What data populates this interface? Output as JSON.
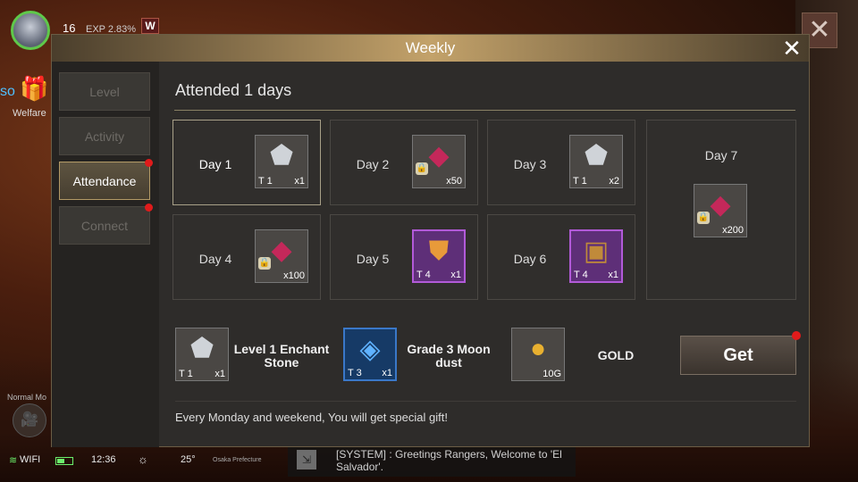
{
  "hud": {
    "level": "16",
    "exp": "EXP 2.83%",
    "badge": "W",
    "side_text": "so",
    "welfare_label": "Welfare",
    "normal_mode": "Normal Mo",
    "close_icon": "close-icon"
  },
  "statusbar": {
    "wifi": "WIFI",
    "time": "12:36",
    "temp": "25°",
    "location": "Osaka Prefecture"
  },
  "chat": {
    "text": "[SYSTEM] : Greetings Rangers, Welcome to 'El Salvador'."
  },
  "dialog": {
    "title": "Weekly",
    "heading": "Attended 1 days",
    "footer": "Every Monday and weekend, You will get special gift!",
    "get_label": "Get"
  },
  "tabs": [
    {
      "label": "Level",
      "active": false,
      "dot": false
    },
    {
      "label": "Activity",
      "active": false,
      "dot": false
    },
    {
      "label": "Attendance",
      "active": true,
      "dot": true
    },
    {
      "label": "Connect",
      "active": false,
      "dot": true
    }
  ],
  "days": [
    {
      "label": "Day 1",
      "item": "enchant-stone",
      "tier": "T 1",
      "qty": "x1",
      "locked": false,
      "current": true
    },
    {
      "label": "Day 2",
      "item": "ruby-gem",
      "tier": "",
      "qty": "x50",
      "locked": true,
      "current": false
    },
    {
      "label": "Day 3",
      "item": "enchant-stone",
      "tier": "T 1",
      "qty": "x2",
      "locked": false,
      "current": false
    },
    {
      "label": "Day 4",
      "item": "ruby-gem",
      "tier": "",
      "qty": "x100",
      "locked": true,
      "current": false
    },
    {
      "label": "Day 5",
      "item": "armor-piece",
      "tier": "T 4",
      "qty": "x1",
      "locked": false,
      "current": false
    },
    {
      "label": "Day 6",
      "item": "treasure-chest",
      "tier": "T 4",
      "qty": "x1",
      "locked": false,
      "current": false
    },
    {
      "label": "Day 7",
      "item": "ruby-gem",
      "tier": "",
      "qty": "x200",
      "locked": true,
      "current": false
    }
  ],
  "rewards": [
    {
      "name": "Level 1 Enchant Stone",
      "tier": "T 1",
      "qty": "x1",
      "item": "enchant-stone"
    },
    {
      "name": "Grade 3 Moon dust",
      "tier": "T 3",
      "qty": "x1",
      "item": "moon-dust"
    },
    {
      "name": "GOLD",
      "tier": "",
      "qty": "10G",
      "item": "gold-coin"
    }
  ],
  "colors": {
    "accent_gold": "#c3a26a",
    "notify_red": "#e01b1b",
    "wifi_green": "#6cf06c",
    "purple_rarity": "#b25ad8",
    "blue_rarity": "#3a78c8"
  }
}
